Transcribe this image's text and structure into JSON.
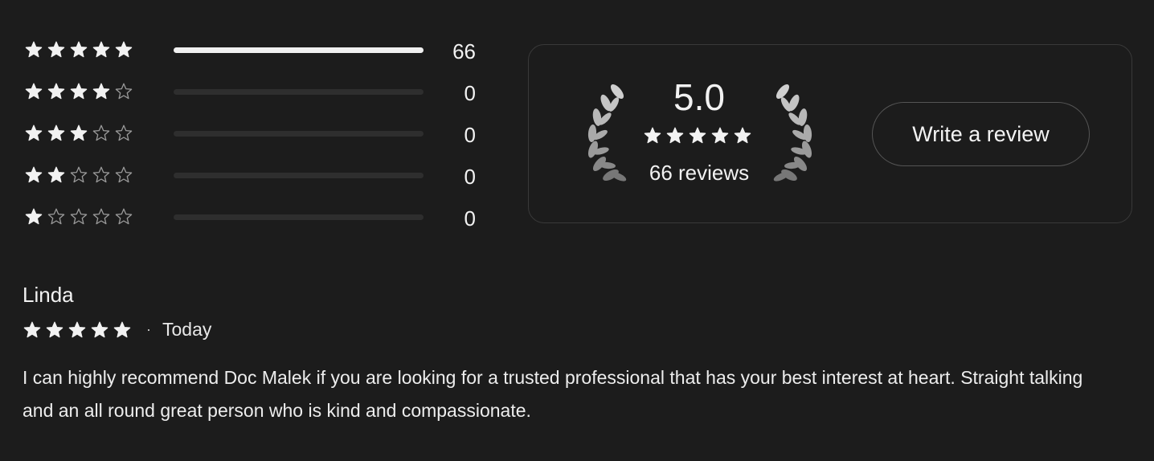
{
  "distribution": [
    {
      "stars": 5,
      "count": "66",
      "fraction": 1.0,
      "bar_color": "#f0f0f0"
    },
    {
      "stars": 4,
      "count": "0",
      "fraction": 0
    },
    {
      "stars": 3,
      "count": "0",
      "fraction": 0
    },
    {
      "stars": 2,
      "count": "0",
      "fraction": 0
    },
    {
      "stars": 1,
      "count": "0",
      "fraction": 0
    }
  ],
  "summary": {
    "average": "5.0",
    "stars": 5,
    "reviews_label": "66 reviews",
    "icon": "laurel-wreath-icon"
  },
  "write_review_label": "Write a review",
  "review": {
    "name": "Linda",
    "stars": 5,
    "separator": "·",
    "date": "Today",
    "text": "I can highly recommend Doc Malek if you are looking for a trusted professional that has your best interest at heart. Straight talking and an all round great person who is kind and compassionate."
  },
  "colors": {
    "background": "#1c1c1c",
    "text": "#f2f2f2",
    "star_filled": "#f2f2f2",
    "star_empty": "#9a9a9a",
    "card_border": "#393939"
  }
}
